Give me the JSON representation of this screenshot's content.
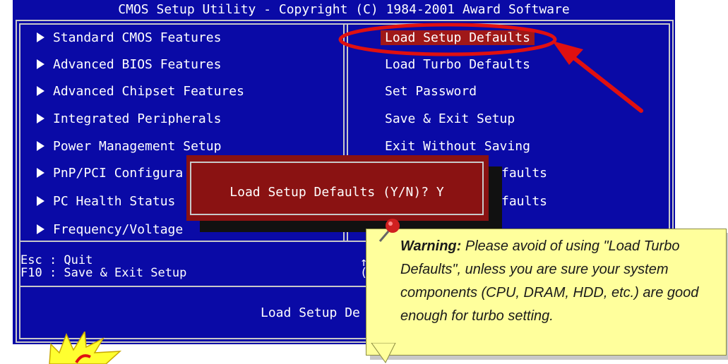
{
  "window": {
    "title": "CMOS Setup Utility - Copyright (C) 1984-2001 Award Software"
  },
  "left_menu": [
    {
      "label": "Standard CMOS Features"
    },
    {
      "label": "Advanced BIOS Features"
    },
    {
      "label": "Advanced Chipset Features"
    },
    {
      "label": "Integrated Peripherals"
    },
    {
      "label": "Power Management Setup"
    },
    {
      "label": "PnP/PCI Configura"
    },
    {
      "label": "PC Health Status"
    },
    {
      "label": "Frequency/Voltage"
    }
  ],
  "right_menu": [
    {
      "label": "Load Setup Defaults"
    },
    {
      "label": "Load Turbo Defaults"
    },
    {
      "label": "Set Password"
    },
    {
      "label": "Save & Exit Setup"
    },
    {
      "label": "Exit Without Saving"
    },
    {
      "label": "faults"
    },
    {
      "label": "faults"
    }
  ],
  "keys": {
    "esc": "Esc : Quit",
    "f10": "F10 : Save & Exit Setup",
    "arrow_fragment": "↑",
    "paren_fragment": "("
  },
  "status_bar": {
    "text": "Load Setup De"
  },
  "dialog": {
    "prompt": "Load Setup Defaults (Y/N)? Y"
  },
  "callout": {
    "label": "Warning:",
    "text": " Please avoid of using \"Load Turbo Defaults\", unless you are sure your system components (CPU, DRAM, HDD, etc.) are good enough for turbo setting."
  },
  "colors": {
    "bios_bg": "#0a0aa6",
    "highlight": "#a01818",
    "annotation_red": "#e01010",
    "callout_bg": "#ffff9c"
  },
  "icons": {
    "pin": "pushpin-icon",
    "burst": "starburst-icon",
    "arrow": "red-arrow"
  }
}
